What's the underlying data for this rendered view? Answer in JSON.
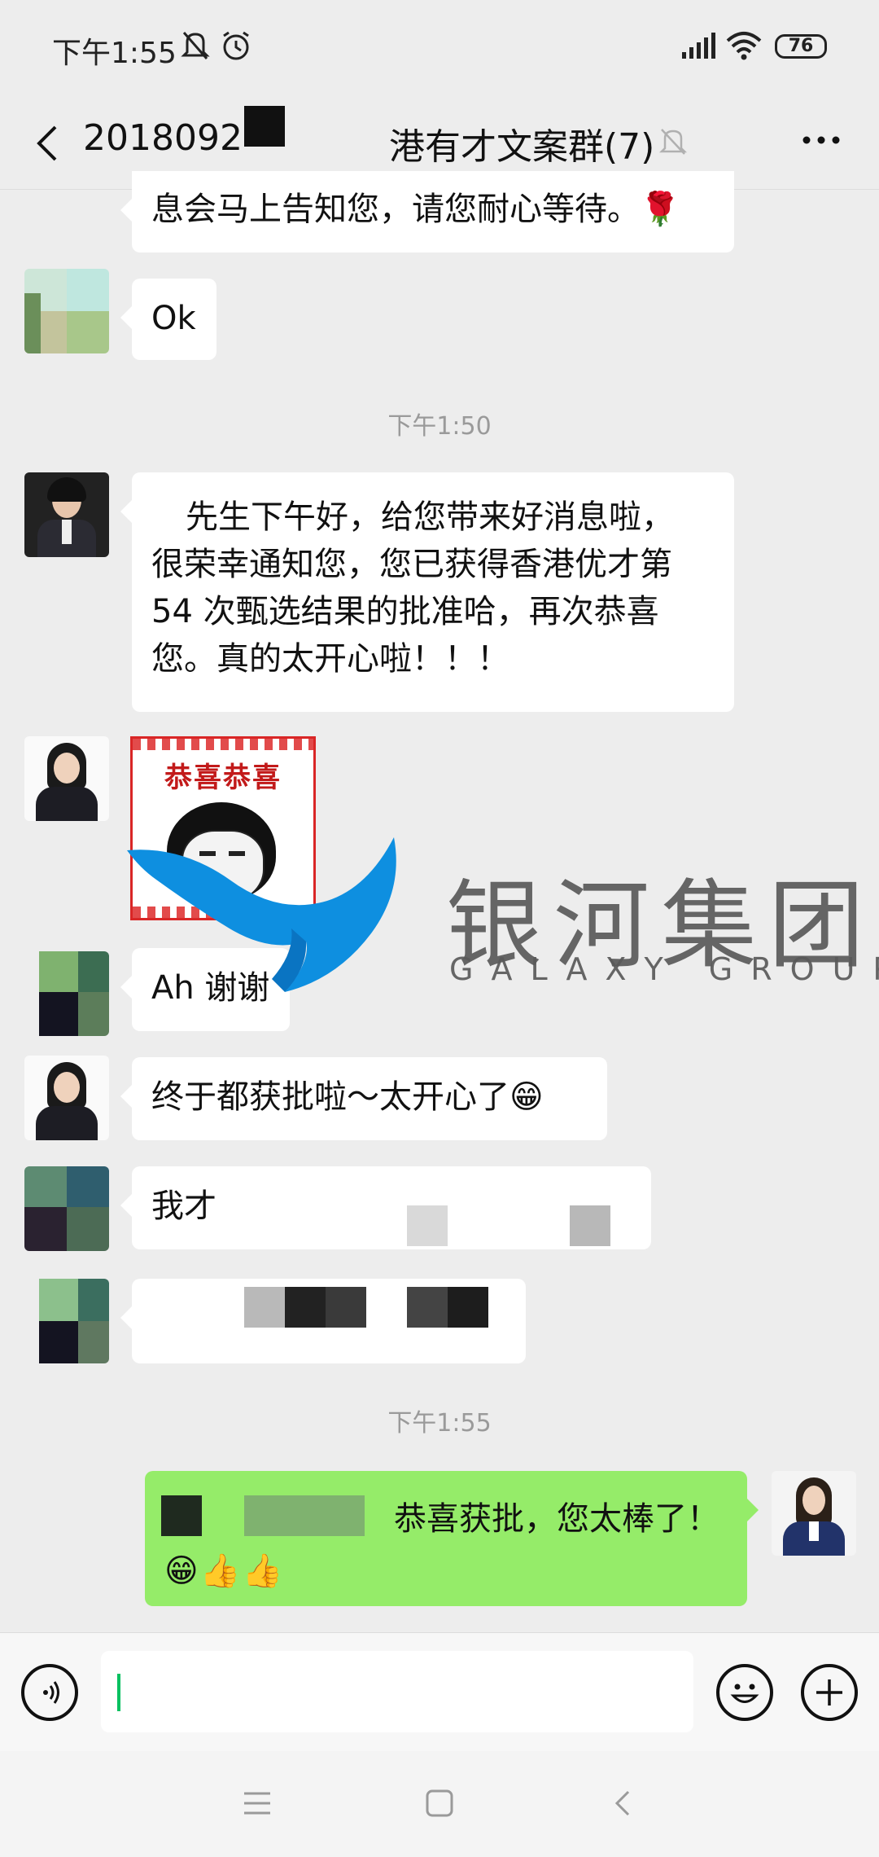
{
  "status_bar": {
    "time": "下午1:55",
    "battery": "76"
  },
  "nav": {
    "title_prefix": "2018092",
    "title_suffix": "港有才文案群(7)"
  },
  "messages": {
    "m1_text": "息会马上告知您，请您耐心等待。🌹",
    "m2_text": "Ok",
    "ts1": "下午1:50",
    "m3_line1": "先生下午好，给您带来好消息啦，",
    "m3_line2": "很荣幸通知您，您已获得香港优才第",
    "m3_line3": "54 次甄选结果的批准哈，再次恭喜",
    "m3_line4": "您。真的太开心啦！！！",
    "sticker_text": "恭喜恭喜",
    "m5_text": "Ah 谢谢",
    "m6_text": "终于都获批啦～太开心了😁",
    "m7_text": "我才",
    "ts2": "下午1:55",
    "m9_text": "恭喜获批，您太棒了！",
    "m9_emoji": "😁👍👍"
  },
  "watermark": {
    "name": "银河集团",
    "sub": "GALAXY GROUP"
  },
  "icons": {
    "back": "chevron-left-icon",
    "more": "more-icon",
    "mute": "bell-off-icon",
    "voice": "voice-icon",
    "emoji": "emoji-icon",
    "plus": "plus-icon"
  }
}
